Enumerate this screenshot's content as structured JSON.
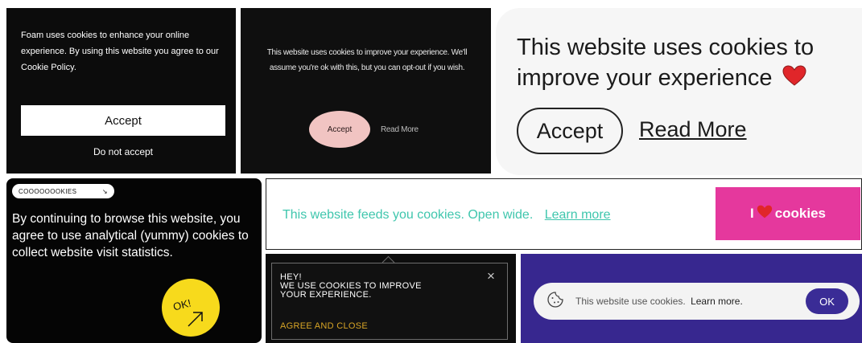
{
  "foam": {
    "message": "Foam uses cookies to enhance your online experience. By using this website you agree to our Cookie Policy.",
    "accept_label": "Accept",
    "decline_label": "Do not accept"
  },
  "dark_pink": {
    "message": "This website uses cookies to improve your experience. We'll assume you're ok with this, but you can opt-out if you wish.",
    "accept_label": "Accept",
    "read_more_label": "Read More"
  },
  "big_light": {
    "message": "This website uses cookies to improve your experience",
    "accept_label": "Accept",
    "read_more_label": "Read More"
  },
  "yummy": {
    "tag_label": "COOOOOOOKIES",
    "tag_arrow": "↘",
    "message": "By continuing to browse this website, you agree to use analytical (yummy) cookies to collect website visit statistics.",
    "ok_label": "OK!",
    "ok_arrow": "↗"
  },
  "feeds": {
    "message": "This website feeds you cookies. Open wide.",
    "learn_more_label": "Learn more",
    "button_prefix": "I",
    "button_suffix": "cookies"
  },
  "hey": {
    "message_line1": "HEY!",
    "message_line2": "WE USE COOKIES TO IMPROVE",
    "message_line3": "YOUR EXPERIENCE.",
    "agree_label": "AGREE AND CLOSE",
    "close_icon": "×"
  },
  "purple": {
    "message": "This website use cookies.",
    "learn_more_label": "Learn more.",
    "ok_label": "OK"
  },
  "colors": {
    "pink_button": "#e5389d",
    "teal_text": "#3fc6ad",
    "yellow_ok": "#f7da1c",
    "purple_bg": "#37278f",
    "gold_link": "#d8a526",
    "heart": "#e0262a"
  }
}
